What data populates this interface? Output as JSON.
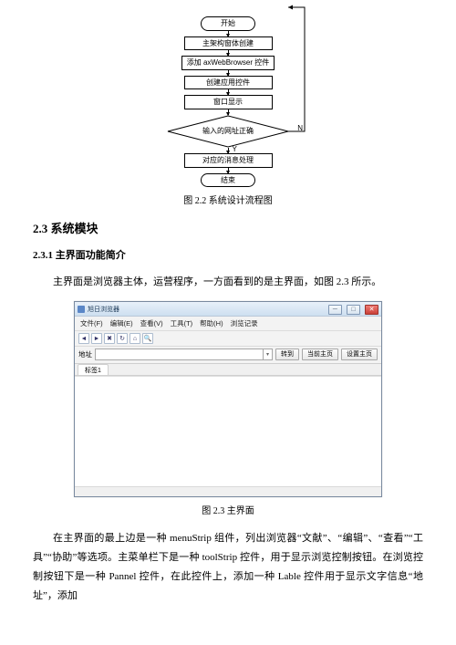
{
  "flow": {
    "start": "开始",
    "s1": "主架构窗体创建",
    "s2": "添加 axWebBrowser 控件",
    "s3": "创建应用控件",
    "s4": "窗口显示",
    "d1": "输入的网址正确",
    "d1_no": "N",
    "d1_yes": "Y",
    "s5": "对应的消息处理",
    "end": "结束"
  },
  "captions": {
    "fig22": "图 2.2  系统设计流程图",
    "fig23": "图 2.3  主界面"
  },
  "headings": {
    "sec23": "2.3  系统模块",
    "sec231": "2.3.1  主界面功能简介"
  },
  "paras": {
    "p1": "主界面是浏览器主体，运营程序，一方面看到的是主界面，如图 2.3 所示。",
    "p2": "在主界面的最上边是一种 menuStrip 组件，列出浏览器“文献”、“编辑”、“查看”“工具”“协助”等选项。主菜单栏下是一种 toolStrip 控件，用于显示浏览控制按钮。在浏览控制按钮下是一种 Pannel 控件，在此控件上，添加一种 Lable 控件用于显示文字信息“地址”，添加"
  },
  "app": {
    "title": "旭日浏览器",
    "menu": [
      "文件(F)",
      "编辑(E)",
      "查看(V)",
      "工具(T)",
      "帮助(H)",
      "浏览记录"
    ],
    "addr_label": "地址",
    "btn_go": "转到",
    "btn_home": "当前主页",
    "btn_sethome": "设置主页",
    "tab1": "标签1"
  }
}
